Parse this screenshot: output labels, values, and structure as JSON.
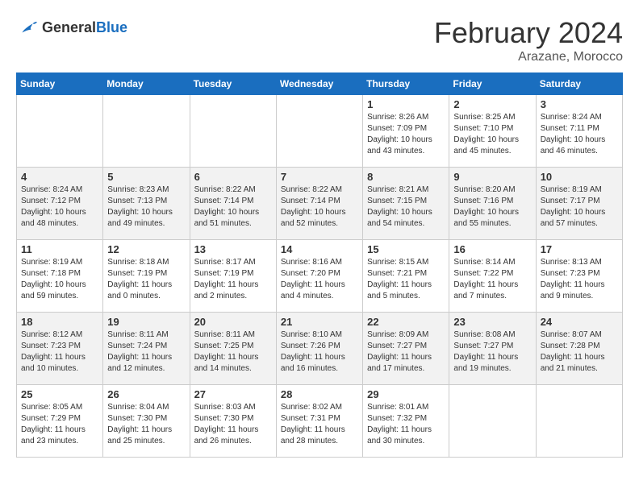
{
  "header": {
    "logo_general": "General",
    "logo_blue": "Blue",
    "month_title": "February 2024",
    "location": "Arazane, Morocco"
  },
  "days_of_week": [
    "Sunday",
    "Monday",
    "Tuesday",
    "Wednesday",
    "Thursday",
    "Friday",
    "Saturday"
  ],
  "weeks": [
    [
      {
        "day": "",
        "info": ""
      },
      {
        "day": "",
        "info": ""
      },
      {
        "day": "",
        "info": ""
      },
      {
        "day": "",
        "info": ""
      },
      {
        "day": "1",
        "info": "Sunrise: 8:26 AM\nSunset: 7:09 PM\nDaylight: 10 hours and 43 minutes."
      },
      {
        "day": "2",
        "info": "Sunrise: 8:25 AM\nSunset: 7:10 PM\nDaylight: 10 hours and 45 minutes."
      },
      {
        "day": "3",
        "info": "Sunrise: 8:24 AM\nSunset: 7:11 PM\nDaylight: 10 hours and 46 minutes."
      }
    ],
    [
      {
        "day": "4",
        "info": "Sunrise: 8:24 AM\nSunset: 7:12 PM\nDaylight: 10 hours and 48 minutes."
      },
      {
        "day": "5",
        "info": "Sunrise: 8:23 AM\nSunset: 7:13 PM\nDaylight: 10 hours and 49 minutes."
      },
      {
        "day": "6",
        "info": "Sunrise: 8:22 AM\nSunset: 7:14 PM\nDaylight: 10 hours and 51 minutes."
      },
      {
        "day": "7",
        "info": "Sunrise: 8:22 AM\nSunset: 7:14 PM\nDaylight: 10 hours and 52 minutes."
      },
      {
        "day": "8",
        "info": "Sunrise: 8:21 AM\nSunset: 7:15 PM\nDaylight: 10 hours and 54 minutes."
      },
      {
        "day": "9",
        "info": "Sunrise: 8:20 AM\nSunset: 7:16 PM\nDaylight: 10 hours and 55 minutes."
      },
      {
        "day": "10",
        "info": "Sunrise: 8:19 AM\nSunset: 7:17 PM\nDaylight: 10 hours and 57 minutes."
      }
    ],
    [
      {
        "day": "11",
        "info": "Sunrise: 8:19 AM\nSunset: 7:18 PM\nDaylight: 10 hours and 59 minutes."
      },
      {
        "day": "12",
        "info": "Sunrise: 8:18 AM\nSunset: 7:19 PM\nDaylight: 11 hours and 0 minutes."
      },
      {
        "day": "13",
        "info": "Sunrise: 8:17 AM\nSunset: 7:19 PM\nDaylight: 11 hours and 2 minutes."
      },
      {
        "day": "14",
        "info": "Sunrise: 8:16 AM\nSunset: 7:20 PM\nDaylight: 11 hours and 4 minutes."
      },
      {
        "day": "15",
        "info": "Sunrise: 8:15 AM\nSunset: 7:21 PM\nDaylight: 11 hours and 5 minutes."
      },
      {
        "day": "16",
        "info": "Sunrise: 8:14 AM\nSunset: 7:22 PM\nDaylight: 11 hours and 7 minutes."
      },
      {
        "day": "17",
        "info": "Sunrise: 8:13 AM\nSunset: 7:23 PM\nDaylight: 11 hours and 9 minutes."
      }
    ],
    [
      {
        "day": "18",
        "info": "Sunrise: 8:12 AM\nSunset: 7:23 PM\nDaylight: 11 hours and 10 minutes."
      },
      {
        "day": "19",
        "info": "Sunrise: 8:11 AM\nSunset: 7:24 PM\nDaylight: 11 hours and 12 minutes."
      },
      {
        "day": "20",
        "info": "Sunrise: 8:11 AM\nSunset: 7:25 PM\nDaylight: 11 hours and 14 minutes."
      },
      {
        "day": "21",
        "info": "Sunrise: 8:10 AM\nSunset: 7:26 PM\nDaylight: 11 hours and 16 minutes."
      },
      {
        "day": "22",
        "info": "Sunrise: 8:09 AM\nSunset: 7:27 PM\nDaylight: 11 hours and 17 minutes."
      },
      {
        "day": "23",
        "info": "Sunrise: 8:08 AM\nSunset: 7:27 PM\nDaylight: 11 hours and 19 minutes."
      },
      {
        "day": "24",
        "info": "Sunrise: 8:07 AM\nSunset: 7:28 PM\nDaylight: 11 hours and 21 minutes."
      }
    ],
    [
      {
        "day": "25",
        "info": "Sunrise: 8:05 AM\nSunset: 7:29 PM\nDaylight: 11 hours and 23 minutes."
      },
      {
        "day": "26",
        "info": "Sunrise: 8:04 AM\nSunset: 7:30 PM\nDaylight: 11 hours and 25 minutes."
      },
      {
        "day": "27",
        "info": "Sunrise: 8:03 AM\nSunset: 7:30 PM\nDaylight: 11 hours and 26 minutes."
      },
      {
        "day": "28",
        "info": "Sunrise: 8:02 AM\nSunset: 7:31 PM\nDaylight: 11 hours and 28 minutes."
      },
      {
        "day": "29",
        "info": "Sunrise: 8:01 AM\nSunset: 7:32 PM\nDaylight: 11 hours and 30 minutes."
      },
      {
        "day": "",
        "info": ""
      },
      {
        "day": "",
        "info": ""
      }
    ]
  ]
}
